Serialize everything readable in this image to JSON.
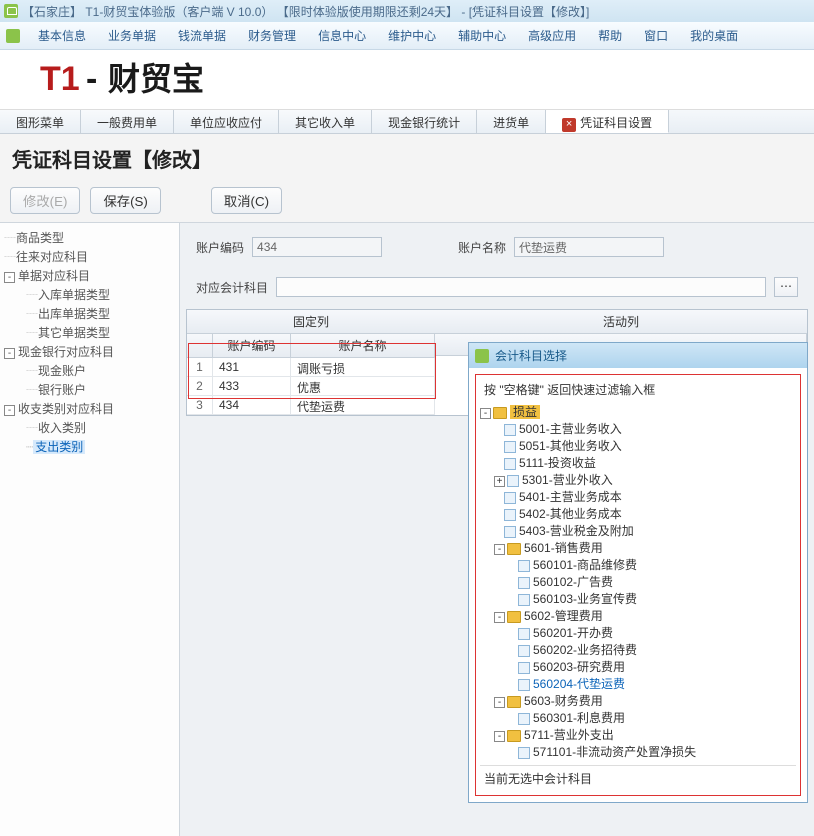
{
  "titlebar": "【石家庄】 T1-财贸宝体验版（客户端 V 10.0） 【限时体验版使用期限还剩24天】 -  [凭证科目设置【修改】]",
  "menu": [
    "基本信息",
    "业务单据",
    "钱流单据",
    "财务管理",
    "信息中心",
    "维护中心",
    "辅助中心",
    "高级应用",
    "帮助",
    "窗口",
    "我的桌面"
  ],
  "brand": {
    "t1": "T1",
    "dash": "-",
    "name": "财贸宝"
  },
  "tabs": [
    "图形菜单",
    "一般费用单",
    "单位应收应付",
    "其它收入单",
    "现金银行统计",
    "进货单",
    "凭证科目设置"
  ],
  "page_title": "凭证科目设置【修改】",
  "buttons": {
    "edit": "修改(E)",
    "save": "保存(S)",
    "cancel": "取消(C)"
  },
  "tree": {
    "n1": "商品类型",
    "n2": "往来对应科目",
    "n3": "单据对应科目",
    "n3a": "入库单据类型",
    "n3b": "出库单据类型",
    "n3c": "其它单据类型",
    "n4": "现金银行对应科目",
    "n4a": "现金账户",
    "n4b": "银行账户",
    "n5": "收支类别对应科目",
    "n5a": "收入类别",
    "n5b": "支出类别"
  },
  "form": {
    "acct_code_label": "账户编码",
    "acct_code": "434",
    "acct_name_label": "账户名称",
    "acct_name": "代垫运费",
    "subj_label": "对应会计科目",
    "subj": ""
  },
  "grid": {
    "fixed_label": "固定列",
    "active_label": "活动列",
    "h_code": "账户编码",
    "h_name": "账户名称",
    "rows": [
      {
        "i": "1",
        "code": "431",
        "name": "调账亏损"
      },
      {
        "i": "2",
        "code": "433",
        "name": "优惠"
      },
      {
        "i": "3",
        "code": "434",
        "name": "代垫运费"
      }
    ]
  },
  "popup": {
    "title": "会计科目选择",
    "hint": "按 \"空格键\" 返回快速过滤输入框",
    "root": "损益",
    "items": [
      "5001-主营业务收入",
      "5051-其他业务收入",
      "5111-投资收益",
      "5301-营业外收入",
      "5401-主营业务成本",
      "5402-其他业务成本",
      "5403-营业税金及附加",
      "5601-销售费用",
      "560101-商品维修费",
      "560102-广告费",
      "560103-业务宣传费",
      "5602-管理费用",
      "560201-开办费",
      "560202-业务招待费",
      "560203-研究费用",
      "560204-代垫运费",
      "5603-财务费用",
      "560301-利息费用",
      "5711-营业外支出",
      "571101-非流动资产处置净损失"
    ],
    "status": "当前无选中会计科目"
  }
}
